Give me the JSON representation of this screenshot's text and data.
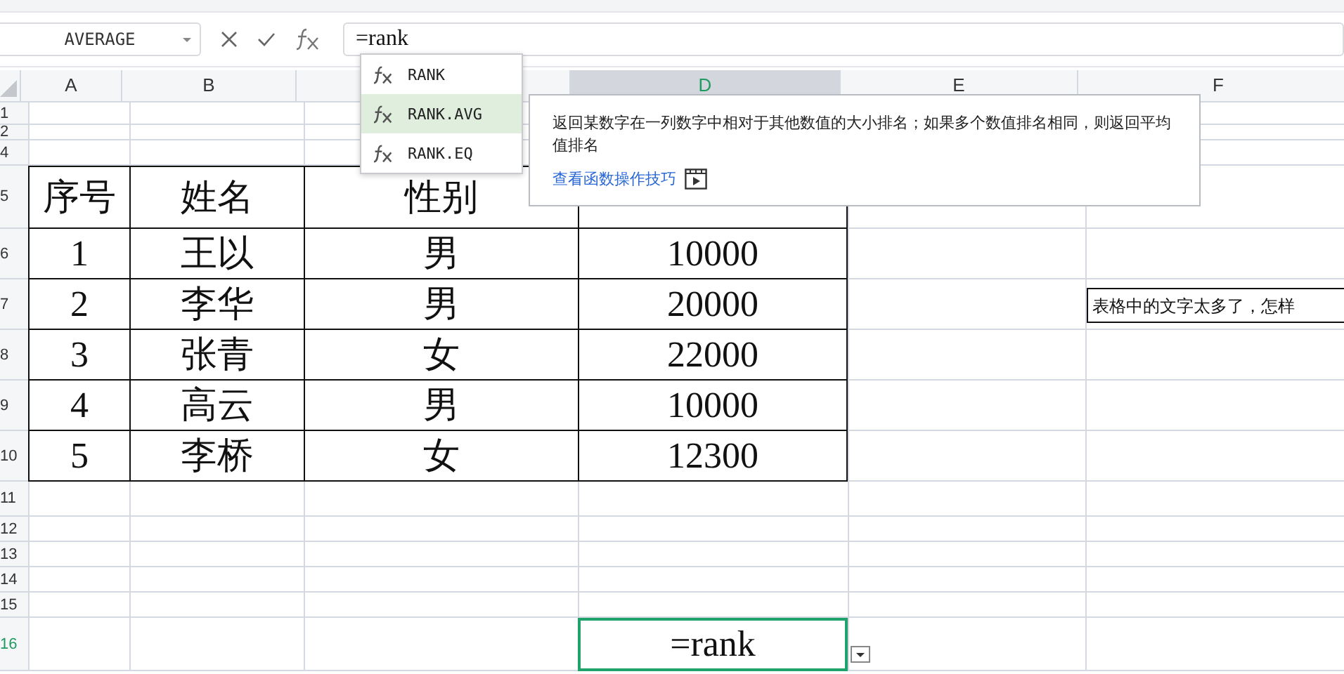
{
  "name_box": "AVERAGE",
  "formula_bar": {
    "value": "=rank"
  },
  "autocomplete": [
    {
      "label": "RANK",
      "selected": false
    },
    {
      "label": "RANK.AVG",
      "selected": true
    },
    {
      "label": "RANK.EQ",
      "selected": false
    }
  ],
  "tooltip": {
    "description": "返回某数字在一列数字中相对于其他数值的大小排名；如果多个数值排名相同，则返回平均值排名",
    "link": "查看函数操作技巧"
  },
  "columns": [
    {
      "label": "A",
      "selected": false
    },
    {
      "label": "B",
      "selected": false
    },
    {
      "selected": false
    },
    {
      "label": "D",
      "selected": true
    },
    {
      "label": "E",
      "selected": false
    },
    {
      "label": "F",
      "selected": false
    }
  ],
  "rows": [
    {
      "label": "1",
      "selected": false
    },
    {
      "label": "2",
      "selected": false
    },
    {
      "label": "4",
      "selected": false
    },
    {
      "label": "5",
      "selected": false,
      "cells": [
        "序号",
        "姓名",
        "性别"
      ]
    },
    {
      "label": "6",
      "selected": false,
      "cells": [
        "1",
        "王以",
        "男",
        "10000"
      ]
    },
    {
      "label": "7",
      "selected": false,
      "cells": [
        "2",
        "李华",
        "男",
        "20000"
      ],
      "note": "表格中的文字太多了，怎样"
    },
    {
      "label": "8",
      "selected": false,
      "cells": [
        "3",
        "张青",
        "女",
        "22000"
      ]
    },
    {
      "label": "9",
      "selected": false,
      "cells": [
        "4",
        "高云",
        "男",
        "10000"
      ]
    },
    {
      "label": "10",
      "selected": false,
      "cells": [
        "5",
        "李桥",
        "女",
        "12300"
      ]
    },
    {
      "label": "11",
      "selected": false
    },
    {
      "label": "12",
      "selected": false
    },
    {
      "label": "13",
      "selected": false
    },
    {
      "label": "14",
      "selected": false
    },
    {
      "label": "15",
      "selected": false
    },
    {
      "label": "16",
      "selected": true,
      "active_cell": "=rank"
    }
  ]
}
